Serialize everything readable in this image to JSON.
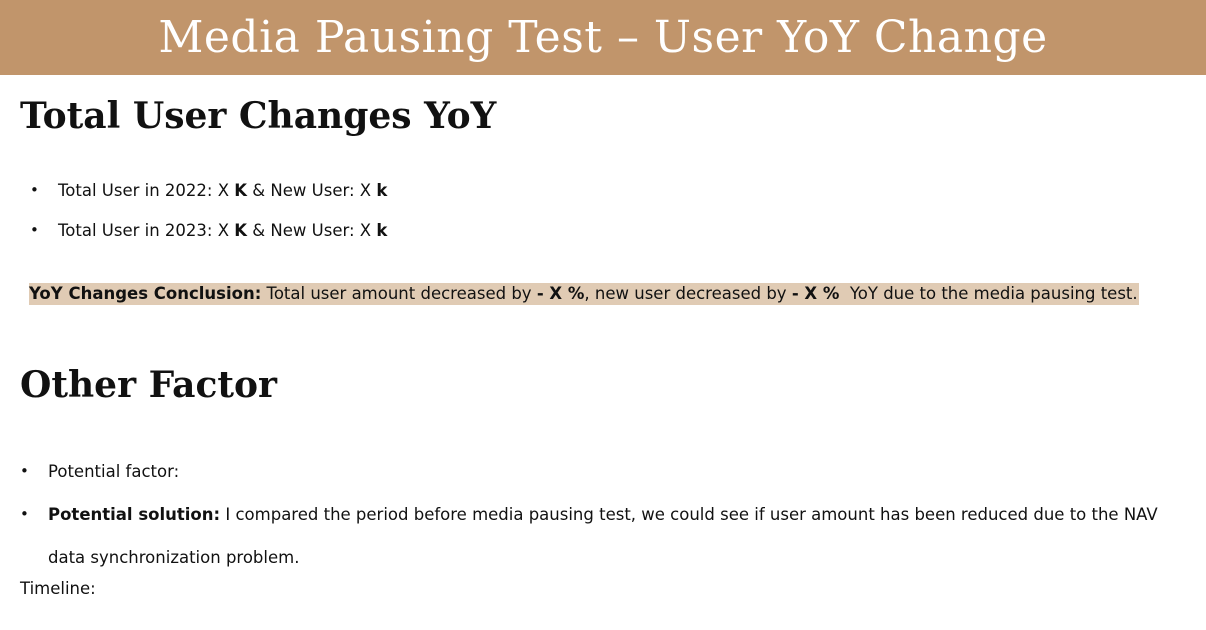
{
  "banner": {
    "title": "Media Pausing Test – User YoY Change",
    "color": "#c1956b"
  },
  "section1": {
    "heading": "Total User Changes YoY",
    "bullets": [
      {
        "prefix": "Total User in 2022: X ",
        "unit1": "K",
        "middle": " & New User: X ",
        "unit2": "k"
      },
      {
        "prefix": "Total User in 2023: X ",
        "unit1": "K",
        "middle": " & New User: X ",
        "unit2": "k"
      }
    ],
    "conclusion": {
      "label": "YoY Changes Conclusion:",
      "text1": " Total user amount decreased by ",
      "value1": "- X %",
      "text2": ", new user decreased by ",
      "value2": "- X %",
      "text3": "  YoY due to the media pausing test.",
      "highlight_color": "#e0cbb4"
    }
  },
  "section2": {
    "heading": "Other Factor",
    "bullets": [
      {
        "text": "Potential factor:"
      },
      {
        "label": "Potential solution:",
        "text": " I compared the period before media pausing test, we could see if user amount has been reduced due to the NAV data synchronization problem."
      }
    ],
    "timeline_label": "Timeline:"
  }
}
